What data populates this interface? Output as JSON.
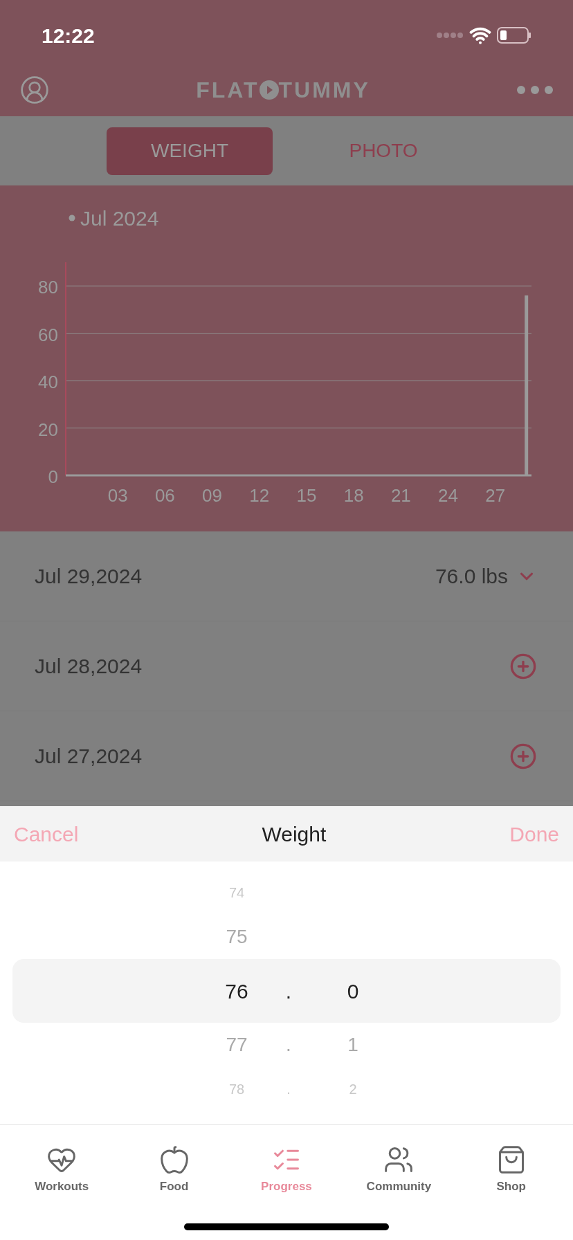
{
  "status_bar": {
    "time": "12:22"
  },
  "header": {
    "logo_left": "FLAT",
    "logo_right": "TUMMY"
  },
  "segments": [
    {
      "label": "WEIGHT",
      "selected": true
    },
    {
      "label": "PHOTO",
      "selected": false
    }
  ],
  "chart": {
    "chart_data": {
      "type": "bar",
      "title": "Jul 2024",
      "x": [
        29
      ],
      "values": [
        76
      ],
      "xlim": [
        0,
        29.3
      ],
      "ylim": [
        0,
        90
      ],
      "xticks": [
        {
          "value": 3,
          "label": "03"
        },
        {
          "value": 6,
          "label": "06"
        },
        {
          "value": 9,
          "label": "09"
        },
        {
          "value": 12,
          "label": "12"
        },
        {
          "value": 15,
          "label": "15"
        },
        {
          "value": 18,
          "label": "18"
        },
        {
          "value": 21,
          "label": "21"
        },
        {
          "value": 24,
          "label": "24"
        },
        {
          "value": 27,
          "label": "27"
        }
      ],
      "yticks": [
        0,
        20,
        40,
        60,
        80
      ],
      "grid": true
    }
  },
  "entries": [
    {
      "kind": "logged",
      "date": "Jul 29,2024",
      "value": "76.0 lbs"
    },
    {
      "kind": "empty",
      "date": "Jul 28,2024"
    },
    {
      "kind": "empty",
      "date": "Jul 27,2024"
    }
  ],
  "picker": {
    "cancel": "Cancel",
    "title": "Weight",
    "done": "Done",
    "rows": [
      {
        "whole": "74",
        "selected": false
      },
      {
        "whole": "75",
        "selected": false
      },
      {
        "whole": "76",
        "separator": ".",
        "decimal": "0",
        "selected": true
      },
      {
        "whole": "77",
        "separator": ".",
        "decimal": "1",
        "selected": false
      },
      {
        "whole": "78",
        "separator": ".",
        "decimal": "2",
        "selected": false
      }
    ]
  },
  "tab_bar": [
    {
      "label": "Workouts",
      "selected": false
    },
    {
      "label": "Food",
      "selected": false
    },
    {
      "label": "Progress",
      "selected": true
    },
    {
      "label": "Community",
      "selected": false
    },
    {
      "label": "Shop",
      "selected": false
    }
  ]
}
